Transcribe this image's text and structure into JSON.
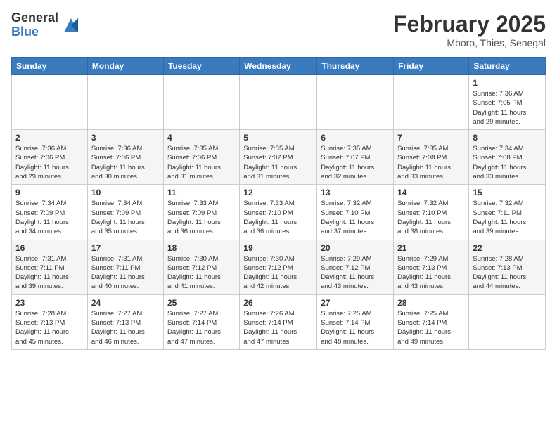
{
  "logo": {
    "general": "General",
    "blue": "Blue"
  },
  "header": {
    "month": "February 2025",
    "location": "Mboro, Thies, Senegal"
  },
  "weekdays": [
    "Sunday",
    "Monday",
    "Tuesday",
    "Wednesday",
    "Thursday",
    "Friday",
    "Saturday"
  ],
  "weeks": [
    [
      {
        "day": "",
        "info": ""
      },
      {
        "day": "",
        "info": ""
      },
      {
        "day": "",
        "info": ""
      },
      {
        "day": "",
        "info": ""
      },
      {
        "day": "",
        "info": ""
      },
      {
        "day": "",
        "info": ""
      },
      {
        "day": "1",
        "info": "Sunrise: 7:36 AM\nSunset: 7:05 PM\nDaylight: 11 hours\nand 29 minutes."
      }
    ],
    [
      {
        "day": "2",
        "info": "Sunrise: 7:36 AM\nSunset: 7:06 PM\nDaylight: 11 hours\nand 29 minutes."
      },
      {
        "day": "3",
        "info": "Sunrise: 7:36 AM\nSunset: 7:06 PM\nDaylight: 11 hours\nand 30 minutes."
      },
      {
        "day": "4",
        "info": "Sunrise: 7:35 AM\nSunset: 7:06 PM\nDaylight: 11 hours\nand 31 minutes."
      },
      {
        "day": "5",
        "info": "Sunrise: 7:35 AM\nSunset: 7:07 PM\nDaylight: 11 hours\nand 31 minutes."
      },
      {
        "day": "6",
        "info": "Sunrise: 7:35 AM\nSunset: 7:07 PM\nDaylight: 11 hours\nand 32 minutes."
      },
      {
        "day": "7",
        "info": "Sunrise: 7:35 AM\nSunset: 7:08 PM\nDaylight: 11 hours\nand 33 minutes."
      },
      {
        "day": "8",
        "info": "Sunrise: 7:34 AM\nSunset: 7:08 PM\nDaylight: 11 hours\nand 33 minutes."
      }
    ],
    [
      {
        "day": "9",
        "info": "Sunrise: 7:34 AM\nSunset: 7:09 PM\nDaylight: 11 hours\nand 34 minutes."
      },
      {
        "day": "10",
        "info": "Sunrise: 7:34 AM\nSunset: 7:09 PM\nDaylight: 11 hours\nand 35 minutes."
      },
      {
        "day": "11",
        "info": "Sunrise: 7:33 AM\nSunset: 7:09 PM\nDaylight: 11 hours\nand 36 minutes."
      },
      {
        "day": "12",
        "info": "Sunrise: 7:33 AM\nSunset: 7:10 PM\nDaylight: 11 hours\nand 36 minutes."
      },
      {
        "day": "13",
        "info": "Sunrise: 7:32 AM\nSunset: 7:10 PM\nDaylight: 11 hours\nand 37 minutes."
      },
      {
        "day": "14",
        "info": "Sunrise: 7:32 AM\nSunset: 7:10 PM\nDaylight: 11 hours\nand 38 minutes."
      },
      {
        "day": "15",
        "info": "Sunrise: 7:32 AM\nSunset: 7:11 PM\nDaylight: 11 hours\nand 39 minutes."
      }
    ],
    [
      {
        "day": "16",
        "info": "Sunrise: 7:31 AM\nSunset: 7:11 PM\nDaylight: 11 hours\nand 39 minutes."
      },
      {
        "day": "17",
        "info": "Sunrise: 7:31 AM\nSunset: 7:11 PM\nDaylight: 11 hours\nand 40 minutes."
      },
      {
        "day": "18",
        "info": "Sunrise: 7:30 AM\nSunset: 7:12 PM\nDaylight: 11 hours\nand 41 minutes."
      },
      {
        "day": "19",
        "info": "Sunrise: 7:30 AM\nSunset: 7:12 PM\nDaylight: 11 hours\nand 42 minutes."
      },
      {
        "day": "20",
        "info": "Sunrise: 7:29 AM\nSunset: 7:12 PM\nDaylight: 11 hours\nand 43 minutes."
      },
      {
        "day": "21",
        "info": "Sunrise: 7:29 AM\nSunset: 7:13 PM\nDaylight: 11 hours\nand 43 minutes."
      },
      {
        "day": "22",
        "info": "Sunrise: 7:28 AM\nSunset: 7:13 PM\nDaylight: 11 hours\nand 44 minutes."
      }
    ],
    [
      {
        "day": "23",
        "info": "Sunrise: 7:28 AM\nSunset: 7:13 PM\nDaylight: 11 hours\nand 45 minutes."
      },
      {
        "day": "24",
        "info": "Sunrise: 7:27 AM\nSunset: 7:13 PM\nDaylight: 11 hours\nand 46 minutes."
      },
      {
        "day": "25",
        "info": "Sunrise: 7:27 AM\nSunset: 7:14 PM\nDaylight: 11 hours\nand 47 minutes."
      },
      {
        "day": "26",
        "info": "Sunrise: 7:26 AM\nSunset: 7:14 PM\nDaylight: 11 hours\nand 47 minutes."
      },
      {
        "day": "27",
        "info": "Sunrise: 7:25 AM\nSunset: 7:14 PM\nDaylight: 11 hours\nand 48 minutes."
      },
      {
        "day": "28",
        "info": "Sunrise: 7:25 AM\nSunset: 7:14 PM\nDaylight: 11 hours\nand 49 minutes."
      },
      {
        "day": "",
        "info": ""
      }
    ]
  ]
}
